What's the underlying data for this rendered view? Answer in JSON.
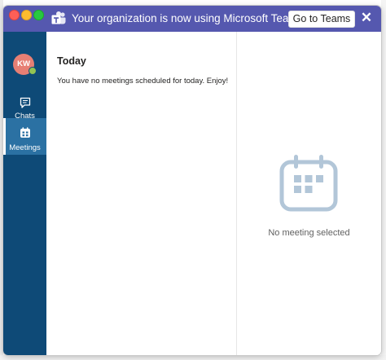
{
  "banner": {
    "message": "Your organization is now using Microsoft Teams!",
    "button_label": "Go to Teams",
    "close_glyph": "✕",
    "logo_icon": "microsoft-teams-logo-icon",
    "background": "#5558af"
  },
  "window_controls": [
    "close",
    "minimize",
    "zoom"
  ],
  "sidebar": {
    "background": "#0e4a77",
    "avatar": {
      "initials": "KW",
      "color": "#e77f74",
      "presence": "available"
    },
    "items": [
      {
        "label": "Chats",
        "icon": "chat-icon",
        "selected": false
      },
      {
        "label": "Meetings",
        "icon": "calendar-icon",
        "selected": true
      }
    ]
  },
  "list": {
    "heading": "Today",
    "empty_message": "You have no meetings scheduled for today. Enjoy!"
  },
  "detail": {
    "empty_message": "No meeting selected",
    "illustration_icon": "calendar-icon",
    "illustration_color": "#b2c6d8"
  }
}
